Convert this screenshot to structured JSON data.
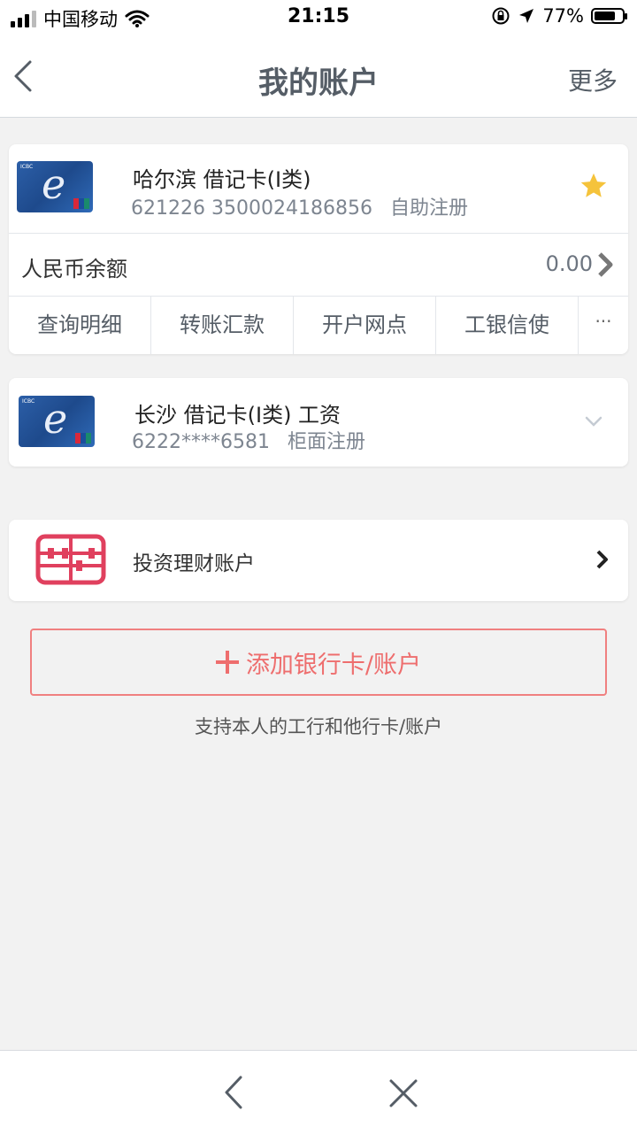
{
  "status_bar": {
    "carrier": "中国移动",
    "time": "21:15",
    "battery_percent": "77%",
    "battery_level": 0.77,
    "icons": [
      "signal-icon",
      "wifi-icon",
      "orientation-lock-icon",
      "location-icon",
      "battery-icon"
    ]
  },
  "nav": {
    "back_icon": "chevron-left-icon",
    "title": "我的账户",
    "more_label": "更多"
  },
  "accounts": [
    {
      "name": "哈尔滨 借记卡(I类)",
      "number": "621226 3500024186856",
      "registration": "自助注册",
      "favorite": true,
      "balance_label": "人民币余额",
      "balance": "0.00",
      "actions": [
        "查询明细",
        "转账汇款",
        "开户网点",
        "工银信使"
      ],
      "more_actions": "···"
    },
    {
      "name": "长沙 借记卡(I类) 工资",
      "number": "6222****6581",
      "registration": "柜面注册",
      "favorite": false
    }
  ],
  "invest": {
    "label": "投资理财账户",
    "icon": "abacus-icon"
  },
  "add_card": {
    "label": "添加银行卡/账户",
    "hint": "支持本人的工行和他行卡/账户"
  },
  "colors": {
    "accent_red": "#ee6e6e",
    "star": "#f5c33b",
    "nav_text": "#555d66",
    "invest_icon": "#e0405e"
  },
  "bottom_bar": {
    "back_icon": "chevron-left-icon",
    "close_icon": "close-icon"
  }
}
